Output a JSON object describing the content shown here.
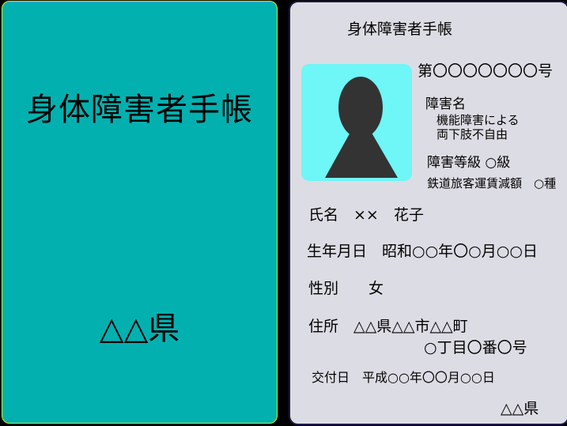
{
  "cover": {
    "title": "身体障害者手帳",
    "prefecture": "△△県"
  },
  "card": {
    "heading": "身体障害者手帳",
    "number": "第〇〇〇〇〇〇〇号",
    "disability_name_label": "障害名",
    "disability_line1": "機能障害による",
    "disability_line2": "両下肢不自由",
    "grade": "障害等級 ○級",
    "railway": "鉄道旅客運賃減額　○種",
    "name": "氏名　××　花子",
    "birthdate": "生年月日　昭和○○年〇○月○○日",
    "sex": "性別　　女",
    "address_line1": "住所　△△県△△市△△町",
    "address_line2": "○丁目〇番〇号",
    "issued": "交付日　平成○○年〇〇月○○日",
    "issuer": "△△県"
  },
  "colors": {
    "background": "#000000",
    "cover": "#03b0b0",
    "page": "#dcdce4",
    "photo_background": "#6ff6f6",
    "silhouette": "#333333"
  }
}
